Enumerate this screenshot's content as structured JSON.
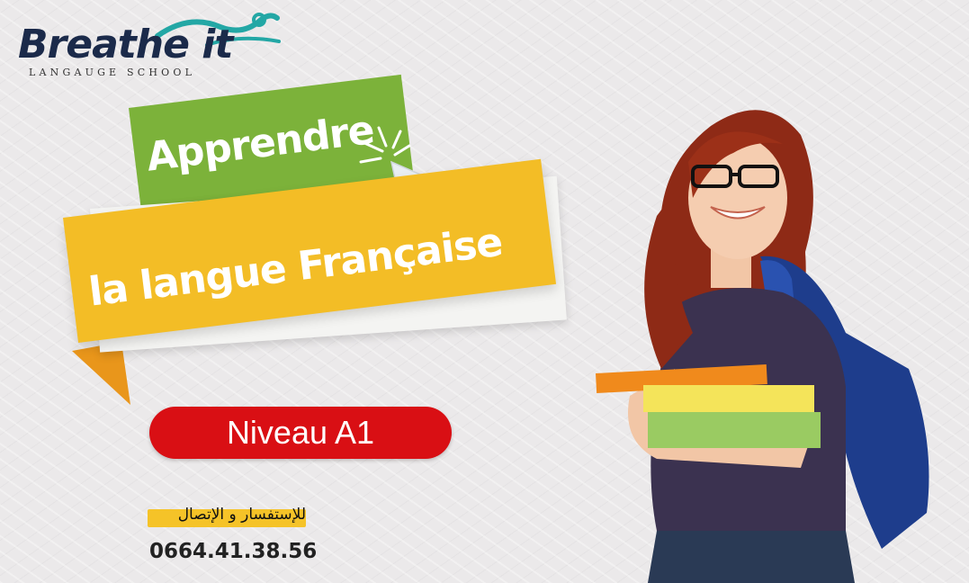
{
  "logo": {
    "word": "Breathe it",
    "tagline": "LANGAUGE SCHOOL",
    "colors": {
      "word": "#1b2a4a",
      "swirl": "#23a7a5"
    }
  },
  "headline": {
    "line1": "Apprendre",
    "line2": "la langue Française"
  },
  "level": {
    "label": "Niveau A1"
  },
  "contact": {
    "label": "للإستفسار و الإتصال",
    "phone": "0664.41.38.56"
  },
  "colors": {
    "green": "#7cb23a",
    "yellow": "#f3bd26",
    "red": "#d90f14",
    "background": "#ebe9ea"
  },
  "icons": [
    "cursor-click-icon",
    "logo-swirl-icon"
  ]
}
